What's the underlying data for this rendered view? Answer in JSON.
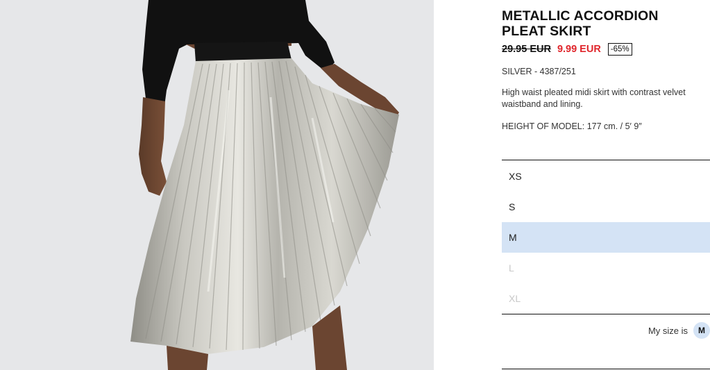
{
  "product": {
    "title": "METALLIC ACCORDION PLEAT SKIRT",
    "old_price": "29.95 EUR",
    "new_price": "9.99 EUR",
    "discount": "-65%",
    "color_ref": "SILVER - 4387/251",
    "description": "High waist pleated midi skirt with contrast velvet waistband and lining.",
    "model_height": "HEIGHT OF MODEL: 177 cm. / 5′ 9″"
  },
  "sizes": [
    {
      "label": "XS",
      "state": "available"
    },
    {
      "label": "S",
      "state": "available"
    },
    {
      "label": "M",
      "state": "selected"
    },
    {
      "label": "L",
      "state": "unavailable"
    },
    {
      "label": "XL",
      "state": "unavailable"
    }
  ],
  "my_size": {
    "label": "My size is",
    "value": "M"
  },
  "colors": {
    "sale_price": "#e0262c",
    "selected_size_bg": "#d4e3f5",
    "photo_background": "#e6e7e9"
  }
}
